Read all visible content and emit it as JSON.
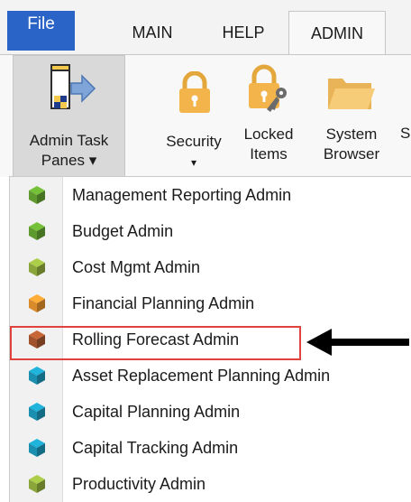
{
  "tabs": {
    "file": "File",
    "main": "MAIN",
    "help": "HELP",
    "admin": "ADMIN"
  },
  "ribbon": {
    "admin_task_panes": {
      "line1": "Admin Task",
      "line2": "Panes ▾"
    },
    "security": {
      "line1": "Security",
      "line2": "▾"
    },
    "locked_items": {
      "line1": "Locked",
      "line2": "Items"
    },
    "system_browser": {
      "line1": "System",
      "line2": "Browser"
    },
    "cut_label": "S"
  },
  "menu": {
    "items": [
      {
        "label": "Management Reporting Admin",
        "color": "#5e9a2e"
      },
      {
        "label": "Budget Admin",
        "color": "#5e9a2e"
      },
      {
        "label": "Cost Mgmt Admin",
        "color": "#8aa53a"
      },
      {
        "label": "Financial Planning Admin",
        "color": "#d98a2b"
      },
      {
        "label": "Rolling Forecast Admin",
        "color": "#a0522d"
      },
      {
        "label": "Asset Replacement Planning Admin",
        "color": "#1a8fb0"
      },
      {
        "label": "Capital Planning Admin",
        "color": "#1a8fb0"
      },
      {
        "label": "Capital Tracking Admin",
        "color": "#1a8fb0"
      },
      {
        "label": "Productivity Admin",
        "color": "#8aa53a"
      }
    ]
  },
  "colors": {
    "file_tab": "#2b64c7",
    "highlight": "#e0433e",
    "lock_gold": "#f2b44b"
  }
}
